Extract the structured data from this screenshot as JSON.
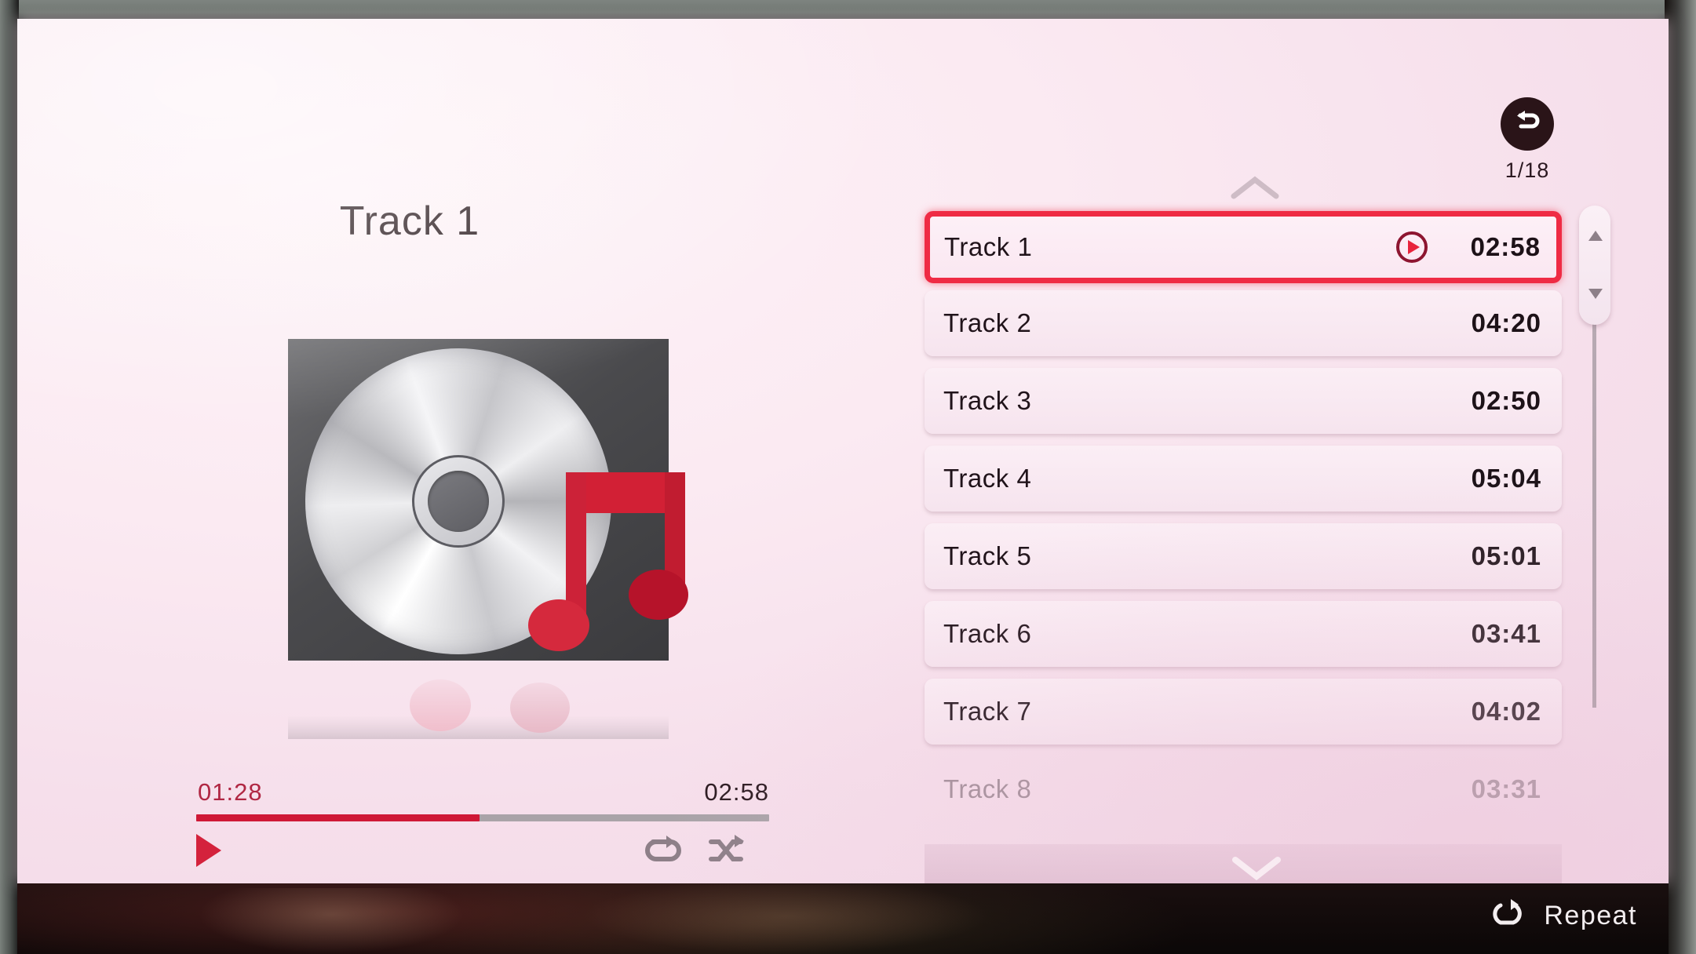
{
  "now_playing": {
    "title": "Track 1",
    "album_art_icon": "cd-music-note-icon",
    "elapsed": "01:28",
    "duration": "02:58",
    "progress_percent": 49.5,
    "play_icon": "play-icon",
    "repeat_icon": "repeat-icon",
    "shuffle_icon": "shuffle-icon"
  },
  "track_panel": {
    "back_icon": "back-arrow-icon",
    "page_counter": "1/18",
    "scroll_up_icon": "chevron-up-icon",
    "scroll_down_icon": "chevron-down-icon",
    "scrollbar_up_icon": "triangle-up-icon",
    "scrollbar_down_icon": "triangle-down-icon",
    "now_playing_icon": "play-circle-icon",
    "tracks": [
      {
        "name": "Track 1",
        "time": "02:58",
        "selected": true,
        "dimmed": false
      },
      {
        "name": "Track 2",
        "time": "04:20",
        "selected": false,
        "dimmed": false
      },
      {
        "name": "Track 3",
        "time": "02:50",
        "selected": false,
        "dimmed": false
      },
      {
        "name": "Track 4",
        "time": "05:04",
        "selected": false,
        "dimmed": false
      },
      {
        "name": "Track 5",
        "time": "05:01",
        "selected": false,
        "dimmed": false
      },
      {
        "name": "Track 6",
        "time": "03:41",
        "selected": false,
        "dimmed": false
      },
      {
        "name": "Track 7",
        "time": "04:02",
        "selected": false,
        "dimmed": false
      },
      {
        "name": "Track 8",
        "time": "03:31",
        "selected": false,
        "dimmed": true
      }
    ]
  },
  "status_bar": {
    "repeat_icon": "repeat-icon",
    "repeat_label": "Repeat"
  },
  "colors": {
    "accent_red": "#ef2b44",
    "progress_red": "#cf1836",
    "screen_pink": "#f6dfeb",
    "text_dark": "#20131a"
  }
}
